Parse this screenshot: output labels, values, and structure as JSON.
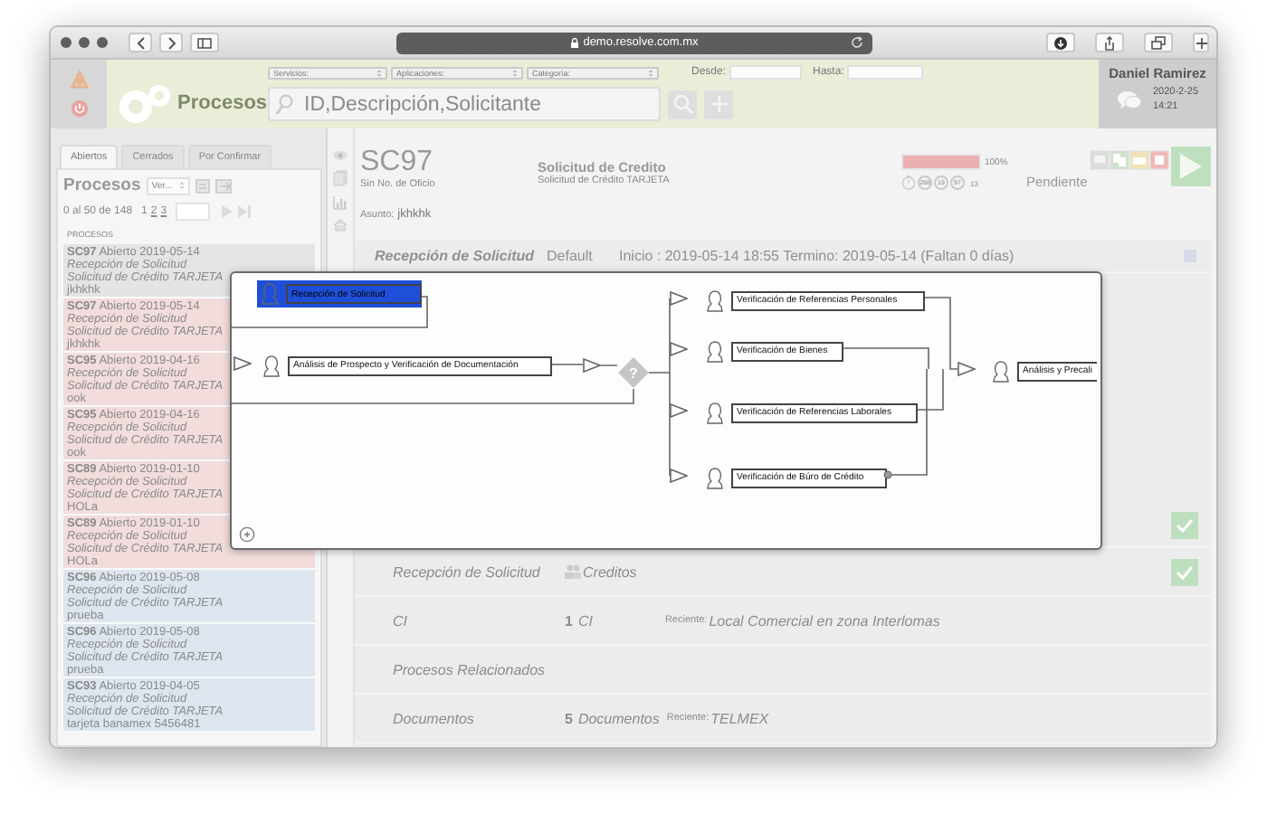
{
  "browser": {
    "url": "demo.resolve.com.mx"
  },
  "header": {
    "title": "Procesos",
    "filters": [
      {
        "label": "Servicios:"
      },
      {
        "label": "Aplicaciones:"
      },
      {
        "label": "Categoría:"
      }
    ],
    "date_from": {
      "label": "Desde:"
    },
    "date_to": {
      "label": "Hasta:"
    },
    "search": {
      "placeholder": "ID,Descripción,Solicitante"
    },
    "user": {
      "name": "Daniel Ramirez",
      "date": "2020-2-25",
      "time": "14:21"
    }
  },
  "sidebar": {
    "tabs": [
      {
        "label": "Abiertos",
        "selected": true
      },
      {
        "label": "Cerrados",
        "selected": false
      },
      {
        "label": "Por Confirmar",
        "selected": false
      }
    ],
    "title": "Procesos",
    "view_select": "Ver...",
    "range": "0 al 50 de 148",
    "pages": [
      {
        "label": "1",
        "selected": true
      },
      {
        "label": "2",
        "selected": false
      },
      {
        "label": "3",
        "selected": false
      }
    ],
    "list_header": "PROCESOS",
    "items": [
      {
        "id": "SC97",
        "status": "Abierto",
        "date": "2019-05-14",
        "task": "Recepción de Solicitud",
        "type": "Solicitud de Crédito TARJETA",
        "note": "jkhkhk",
        "color": "#e4e4e4"
      },
      {
        "id": "SC97",
        "status": "Abierto",
        "date": "2019-05-14",
        "task": "Recepción de Solicitud",
        "type": "Solicitud de Crédito TARJETA",
        "note": "jkhkhk",
        "color": "#f2dcdc"
      },
      {
        "id": "SC95",
        "status": "Abierto",
        "date": "2019-04-16",
        "task": "Recepción de Solicitud",
        "type": "Solicitud de Crédito TARJETA",
        "note": "ook",
        "color": "#f2dcdc"
      },
      {
        "id": "SC95",
        "status": "Abierto",
        "date": "2019-04-16",
        "task": "Recepción de Solicitud",
        "type": "Solicitud de Crédito TARJETA",
        "note": "ook",
        "color": "#f2dcdc"
      },
      {
        "id": "SC89",
        "status": "Abierto",
        "date": "2019-01-10",
        "task": "Recepción de Solicitud",
        "type": "Solicitud de Crédito TARJETA",
        "note": "HOLa",
        "color": "#f2dcdc"
      },
      {
        "id": "SC89",
        "status": "Abierto",
        "date": "2019-01-10",
        "task": "Recepción de Solicitud",
        "type": "Solicitud de Crédito TARJETA",
        "note": "HOLa",
        "color": "#f2dcdc"
      },
      {
        "id": "SC96",
        "status": "Abierto",
        "date": "2019-05-08",
        "task": "Recepción de Solicitud",
        "type": "Solicitud de Crédito TARJETA",
        "note": "prueba",
        "color": "#dde6ef"
      },
      {
        "id": "SC96",
        "status": "Abierto",
        "date": "2019-05-08",
        "task": "Recepción de Solicitud",
        "type": "Solicitud de Crédito TARJETA",
        "note": "prueba",
        "color": "#dde6ef"
      },
      {
        "id": "SC93",
        "status": "Abierto",
        "date": "2019-04-05",
        "task": "Recepción de Solicitud",
        "type": "Solicitud de Crédito TARJETA",
        "note": "tarjeta banamex 5456481",
        "color": "#dde6ef"
      }
    ]
  },
  "detail": {
    "id": "SC97",
    "office": "Sin No. de Oficio",
    "subject_label": "Asunto:",
    "subject": "jkhkhk",
    "process": "Solicitud de Credito",
    "process_type": "Solicitud de Crédito TARJETA",
    "progress": {
      "level": 1,
      "reading": "100%"
    },
    "counters": [
      "288",
      "19",
      "97"
    ],
    "counter_extra": "13",
    "status": "Pendiente",
    "current_task": {
      "name": "Recepción de Solicitud",
      "assignee": "Default",
      "schedule": "Inicio : 2019-05-14 18:55 Termino: 2019-05-14 (Faltan 0 días)"
    },
    "rows": [
      {
        "kind": "covered",
        "checked": true
      },
      {
        "kind": "task",
        "label": "Recepción de Solicitud",
        "group": "Creditos",
        "checked": true
      },
      {
        "kind": "count",
        "label": "CI",
        "count": "1",
        "unit": "CI",
        "recent_label": "Reciente:",
        "recent": "Local Comercial en zona Interlomas"
      },
      {
        "kind": "plain",
        "label": "Procesos Relacionados"
      },
      {
        "kind": "count",
        "label": "Documentos",
        "count": "5",
        "unit": "Documentos",
        "recent_label": "Reciente:",
        "recent": "TELMEX"
      }
    ]
  },
  "flow_dialog": {
    "nodes": [
      {
        "kind": "task",
        "label": "Recepción de Solicitud",
        "selected": true
      },
      {
        "kind": "task",
        "label": "Análisis de Prospecto y Verificación de Documentación",
        "selected": false
      },
      {
        "kind": "gateway",
        "label": "?"
      },
      {
        "kind": "task",
        "label": "Verificación de Referencias Personales",
        "selected": false
      },
      {
        "kind": "task",
        "label": "Verificación de Bienes",
        "selected": false
      },
      {
        "kind": "task",
        "label": "Verificación de Referencias Laborales",
        "selected": false
      },
      {
        "kind": "task",
        "label": "Verificación de Búro de Crédito",
        "selected": false
      },
      {
        "kind": "task",
        "label": "Análisis y Precali",
        "selected": false
      }
    ]
  }
}
